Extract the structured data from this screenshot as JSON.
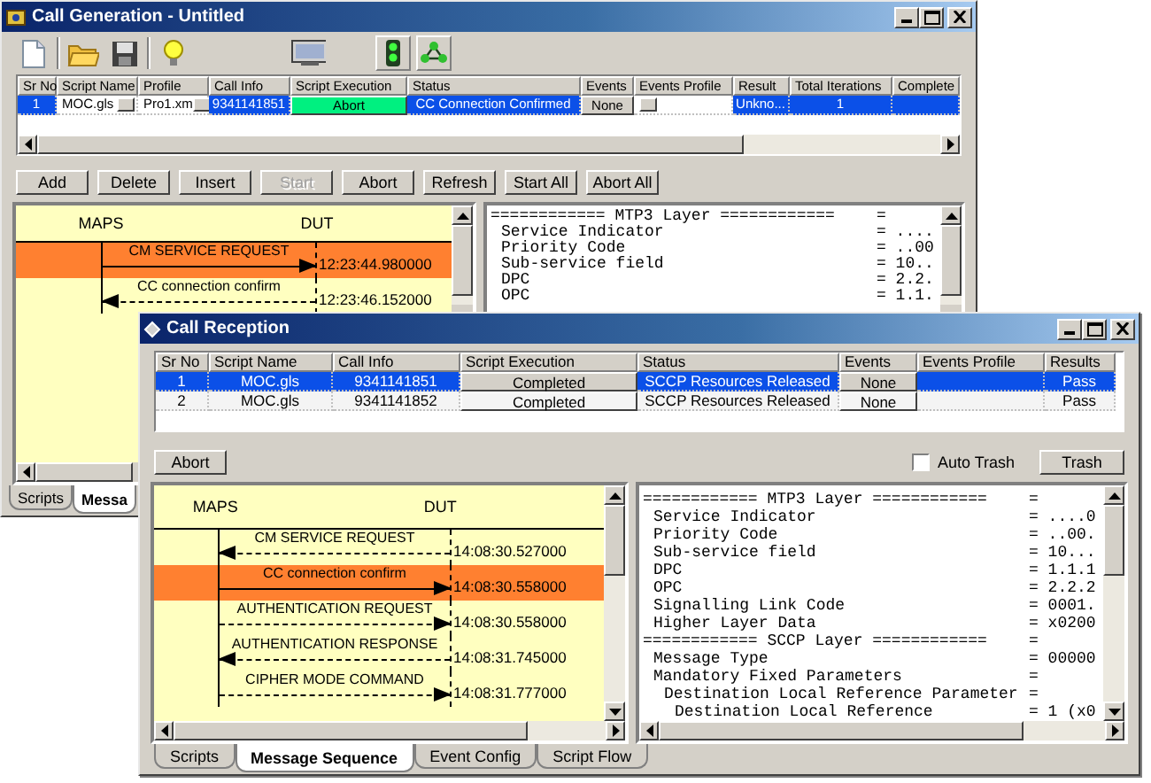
{
  "call_generation": {
    "title": "Call Generation - Untitled",
    "table": {
      "columns": [
        "Sr No",
        "Script Name",
        "Profile",
        "Call Info",
        "Script Execution",
        "Status",
        "Events",
        "Events Profile",
        "Result",
        "Total Iterations",
        "Complete"
      ],
      "rows": [
        {
          "selected": true,
          "cells": [
            {
              "kind": "text",
              "text": "1"
            },
            {
              "kind": "picker",
              "text": "MOC.gls"
            },
            {
              "kind": "picker",
              "text": "Pro1.xm"
            },
            {
              "kind": "text",
              "text": "9341141851"
            },
            {
              "kind": "button",
              "text": "Abort",
              "highlighted": true
            },
            {
              "kind": "text",
              "text": "CC Connection Confirmed"
            },
            {
              "kind": "button",
              "text": "None",
              "highlighted": false
            },
            {
              "kind": "picker"
            },
            {
              "kind": "text",
              "text": "Unkno..."
            },
            {
              "kind": "text",
              "text": "1"
            },
            {
              "kind": "text"
            }
          ]
        }
      ]
    },
    "buttons": [
      {
        "label": "Add",
        "disabled": false
      },
      {
        "label": "Delete",
        "disabled": false
      },
      {
        "label": "Insert",
        "disabled": false
      },
      {
        "label": "Start",
        "disabled": true
      },
      {
        "label": "Abort",
        "disabled": false
      },
      {
        "label": "Refresh",
        "disabled": false
      },
      {
        "label": "Start All",
        "disabled": false
      },
      {
        "label": "Abort All",
        "disabled": false
      }
    ],
    "sequence": {
      "lifelines": [
        "MAPS",
        "DUT"
      ],
      "messages": [
        {
          "label": "CM SERVICE REQUEST",
          "kind": "rightward",
          "time": "12:23:44.980000",
          "selected": true
        },
        {
          "label": "CC connection confirm",
          "kind": "leftward",
          "time": "12:23:46.152000",
          "selected": false
        }
      ]
    },
    "decode": [
      {
        "text": "============ MTP3 Layer ============",
        "value": "=",
        "children": [
          {
            "text": "Service Indicator",
            "value": "= ...."
          },
          {
            "text": "Priority Code",
            "value": "= ..00"
          },
          {
            "text": "Sub-service field",
            "value": "= 10.."
          },
          {
            "text": "DPC",
            "value": "= 2.2."
          },
          {
            "text": "OPC",
            "value": "= 1.1."
          }
        ]
      }
    ],
    "tabs": [
      {
        "label": "Scripts",
        "selected": false
      },
      {
        "label": "Messa",
        "selected": true
      }
    ]
  },
  "call_reception": {
    "title": "Call Reception",
    "table": {
      "columns": [
        "Sr No",
        "Script Name",
        "Call Info",
        "Script Execution",
        "Status",
        "Events",
        "Events Profile",
        "Results"
      ],
      "rows": [
        {
          "selected": true,
          "cells": [
            {
              "kind": "text",
              "text": "1"
            },
            {
              "kind": "text",
              "text": "MOC.gls"
            },
            {
              "kind": "text",
              "text": "9341141851"
            },
            {
              "kind": "button",
              "text": "Completed",
              "highlighted": false
            },
            {
              "kind": "text",
              "text": "SCCP Resources Released"
            },
            {
              "kind": "button",
              "text": "None",
              "highlighted": false
            },
            {
              "kind": "text"
            },
            {
              "kind": "text",
              "text": "Pass"
            }
          ]
        },
        {
          "selected": false,
          "cells": [
            {
              "kind": "text",
              "text": "2"
            },
            {
              "kind": "text",
              "text": "MOC.gls"
            },
            {
              "kind": "text",
              "text": "9341141852"
            },
            {
              "kind": "button",
              "text": "Completed",
              "highlighted": false
            },
            {
              "kind": "text",
              "text": "SCCP Resources Released"
            },
            {
              "kind": "button",
              "text": "None",
              "highlighted": false
            },
            {
              "kind": "text"
            },
            {
              "kind": "text",
              "text": "Pass"
            }
          ]
        }
      ]
    },
    "abort_button": {
      "label": "Abort"
    },
    "auto_trash": {
      "label": "Auto Trash",
      "checked": false
    },
    "trash_button": {
      "label": "Trash"
    },
    "sequence": {
      "lifelines": [
        "MAPS",
        "DUT"
      ],
      "messages": [
        {
          "label": "CM SERVICE REQUEST",
          "kind": "leftward",
          "time": "14:08:30.527000",
          "selected": false
        },
        {
          "label": "CC connection confirm",
          "kind": "rightward",
          "time": "14:08:30.558000",
          "selected": true
        },
        {
          "label": "AUTHENTICATION REQUEST",
          "kind": "rightward",
          "time": "14:08:30.558000",
          "selected": false
        },
        {
          "label": "AUTHENTICATION RESPONSE",
          "kind": "leftward",
          "time": "14:08:31.745000",
          "selected": false
        },
        {
          "label": "CIPHER MODE COMMAND",
          "kind": "rightward",
          "time": "14:08:31.777000",
          "selected": false
        }
      ]
    },
    "decode": [
      {
        "text": "============ MTP3 Layer ============",
        "value": "=",
        "children": [
          {
            "text": "Service Indicator",
            "value": "= ....0"
          },
          {
            "text": "Priority Code",
            "value": "= ..00."
          },
          {
            "text": "Sub-service field",
            "value": "= 10..."
          },
          {
            "text": "DPC",
            "value": "= 1.1.1"
          },
          {
            "text": "OPC",
            "value": "= 2.2.2"
          },
          {
            "text": "Signalling Link Code",
            "value": "= 0001."
          },
          {
            "text": "Higher Layer Data",
            "value": "= x0200"
          }
        ]
      },
      {
        "text": "============ SCCP Layer ============",
        "value": "=",
        "children": [
          {
            "text": "Message Type",
            "value": "= 00000"
          },
          {
            "text": "Mandatory Fixed Parameters",
            "value": "=",
            "children": [
              {
                "text": "Destination Local Reference Parameter",
                "value": "=",
                "children": [
                  {
                    "text": "Destination Local Reference",
                    "value": "= 1 (x0"
                  }
                ]
              }
            ]
          }
        ]
      }
    ],
    "tabs": [
      {
        "label": "Scripts",
        "selected": false
      },
      {
        "label": "Message Sequence",
        "selected": true
      },
      {
        "label": "Event Config",
        "selected": false
      },
      {
        "label": "Script Flow",
        "selected": false
      }
    ]
  }
}
